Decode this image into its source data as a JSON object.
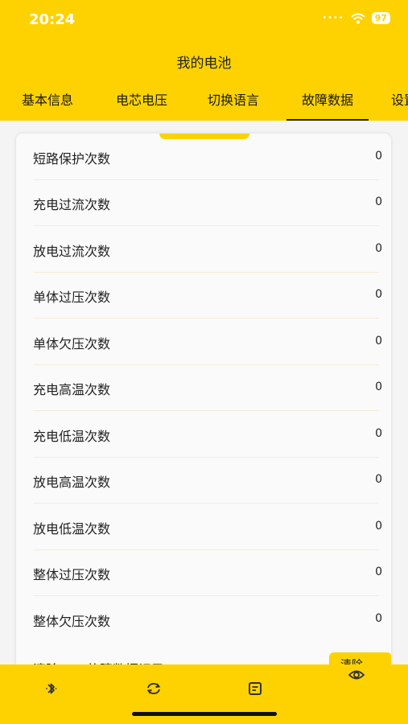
{
  "status": {
    "time": "20:24",
    "battery": "97"
  },
  "header": {
    "title": "我的电池"
  },
  "tabs": [
    {
      "label": "基本信息",
      "active": false
    },
    {
      "label": "电芯电压",
      "active": false
    },
    {
      "label": "切换语言",
      "active": false
    },
    {
      "label": "故障数据",
      "active": true
    },
    {
      "label": "设置",
      "active": false
    }
  ],
  "fault_rows": [
    {
      "label": "短路保护次数",
      "value": "0"
    },
    {
      "label": "充电过流次数",
      "value": "0"
    },
    {
      "label": "放电过流次数",
      "value": "0"
    },
    {
      "label": "单体过压次数",
      "value": "0"
    },
    {
      "label": "单体欠压次数",
      "value": "0"
    },
    {
      "label": "充电高温次数",
      "value": "0"
    },
    {
      "label": "充电低温次数",
      "value": "0"
    },
    {
      "label": "放电高温次数",
      "value": "0"
    },
    {
      "label": "放电低温次数",
      "value": "0"
    },
    {
      "label": "整体过压次数",
      "value": "0"
    },
    {
      "label": "整体欠压次数",
      "value": "0"
    }
  ],
  "clear_row": {
    "label": "清除BMS故障数据记录",
    "button_label": "清除"
  },
  "bottom_nav": [
    {
      "icon": "bluetooth-icon"
    },
    {
      "icon": "refresh-icon"
    },
    {
      "icon": "document-icon"
    },
    {
      "icon": "eye-icon"
    }
  ],
  "colors": {
    "accent": "#fdd200",
    "background": "#f4f4f4"
  }
}
